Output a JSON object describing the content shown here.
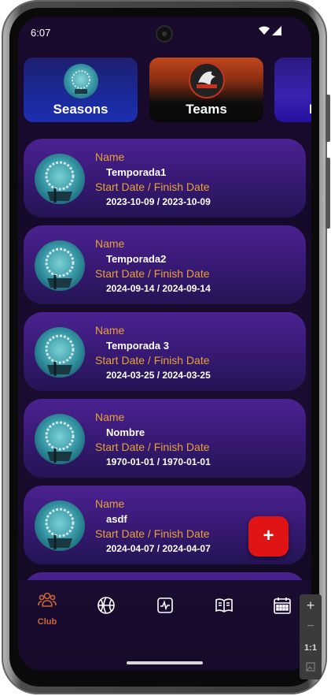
{
  "status_bar": {
    "time": "6:07"
  },
  "categories": [
    {
      "label": "Seasons"
    },
    {
      "label": "Teams"
    },
    {
      "label": "I"
    }
  ],
  "seasons": [
    {
      "name_label": "Name",
      "name": "Temporada1",
      "dates_label": "Start Date / Finish Date",
      "dates": "2023-10-09 / 2023-10-09"
    },
    {
      "name_label": "Name",
      "name": "Temporada2",
      "dates_label": "Start Date / Finish Date",
      "dates": "2024-09-14 / 2024-09-14"
    },
    {
      "name_label": "Name",
      "name": "Temporada 3",
      "dates_label": "Start Date / Finish Date",
      "dates": "2024-03-25 / 2024-03-25"
    },
    {
      "name_label": "Name",
      "name": "Nombre",
      "dates_label": "Start Date / Finish Date",
      "dates": "1970-01-01 / 1970-01-01"
    },
    {
      "name_label": "Name",
      "name": "asdf",
      "dates_label": "Start Date / Finish Date",
      "dates": "2024-04-07 / 2024-04-07"
    }
  ],
  "fab": {
    "label": "+"
  },
  "bottom_nav": [
    {
      "icon": "club-icon",
      "label": "Club",
      "active": true
    },
    {
      "icon": "basketball-icon"
    },
    {
      "icon": "activity-icon"
    },
    {
      "icon": "book-icon"
    },
    {
      "icon": "calendar-icon"
    }
  ],
  "zoom_controls": {
    "plus": "+",
    "minus": "−",
    "ratio": "1:1"
  },
  "colors": {
    "accent_label": "#e8a23a",
    "fab": "#e01414",
    "active_nav": "#c9663a",
    "card_top": "#4a2290",
    "card_bottom": "#241454"
  }
}
